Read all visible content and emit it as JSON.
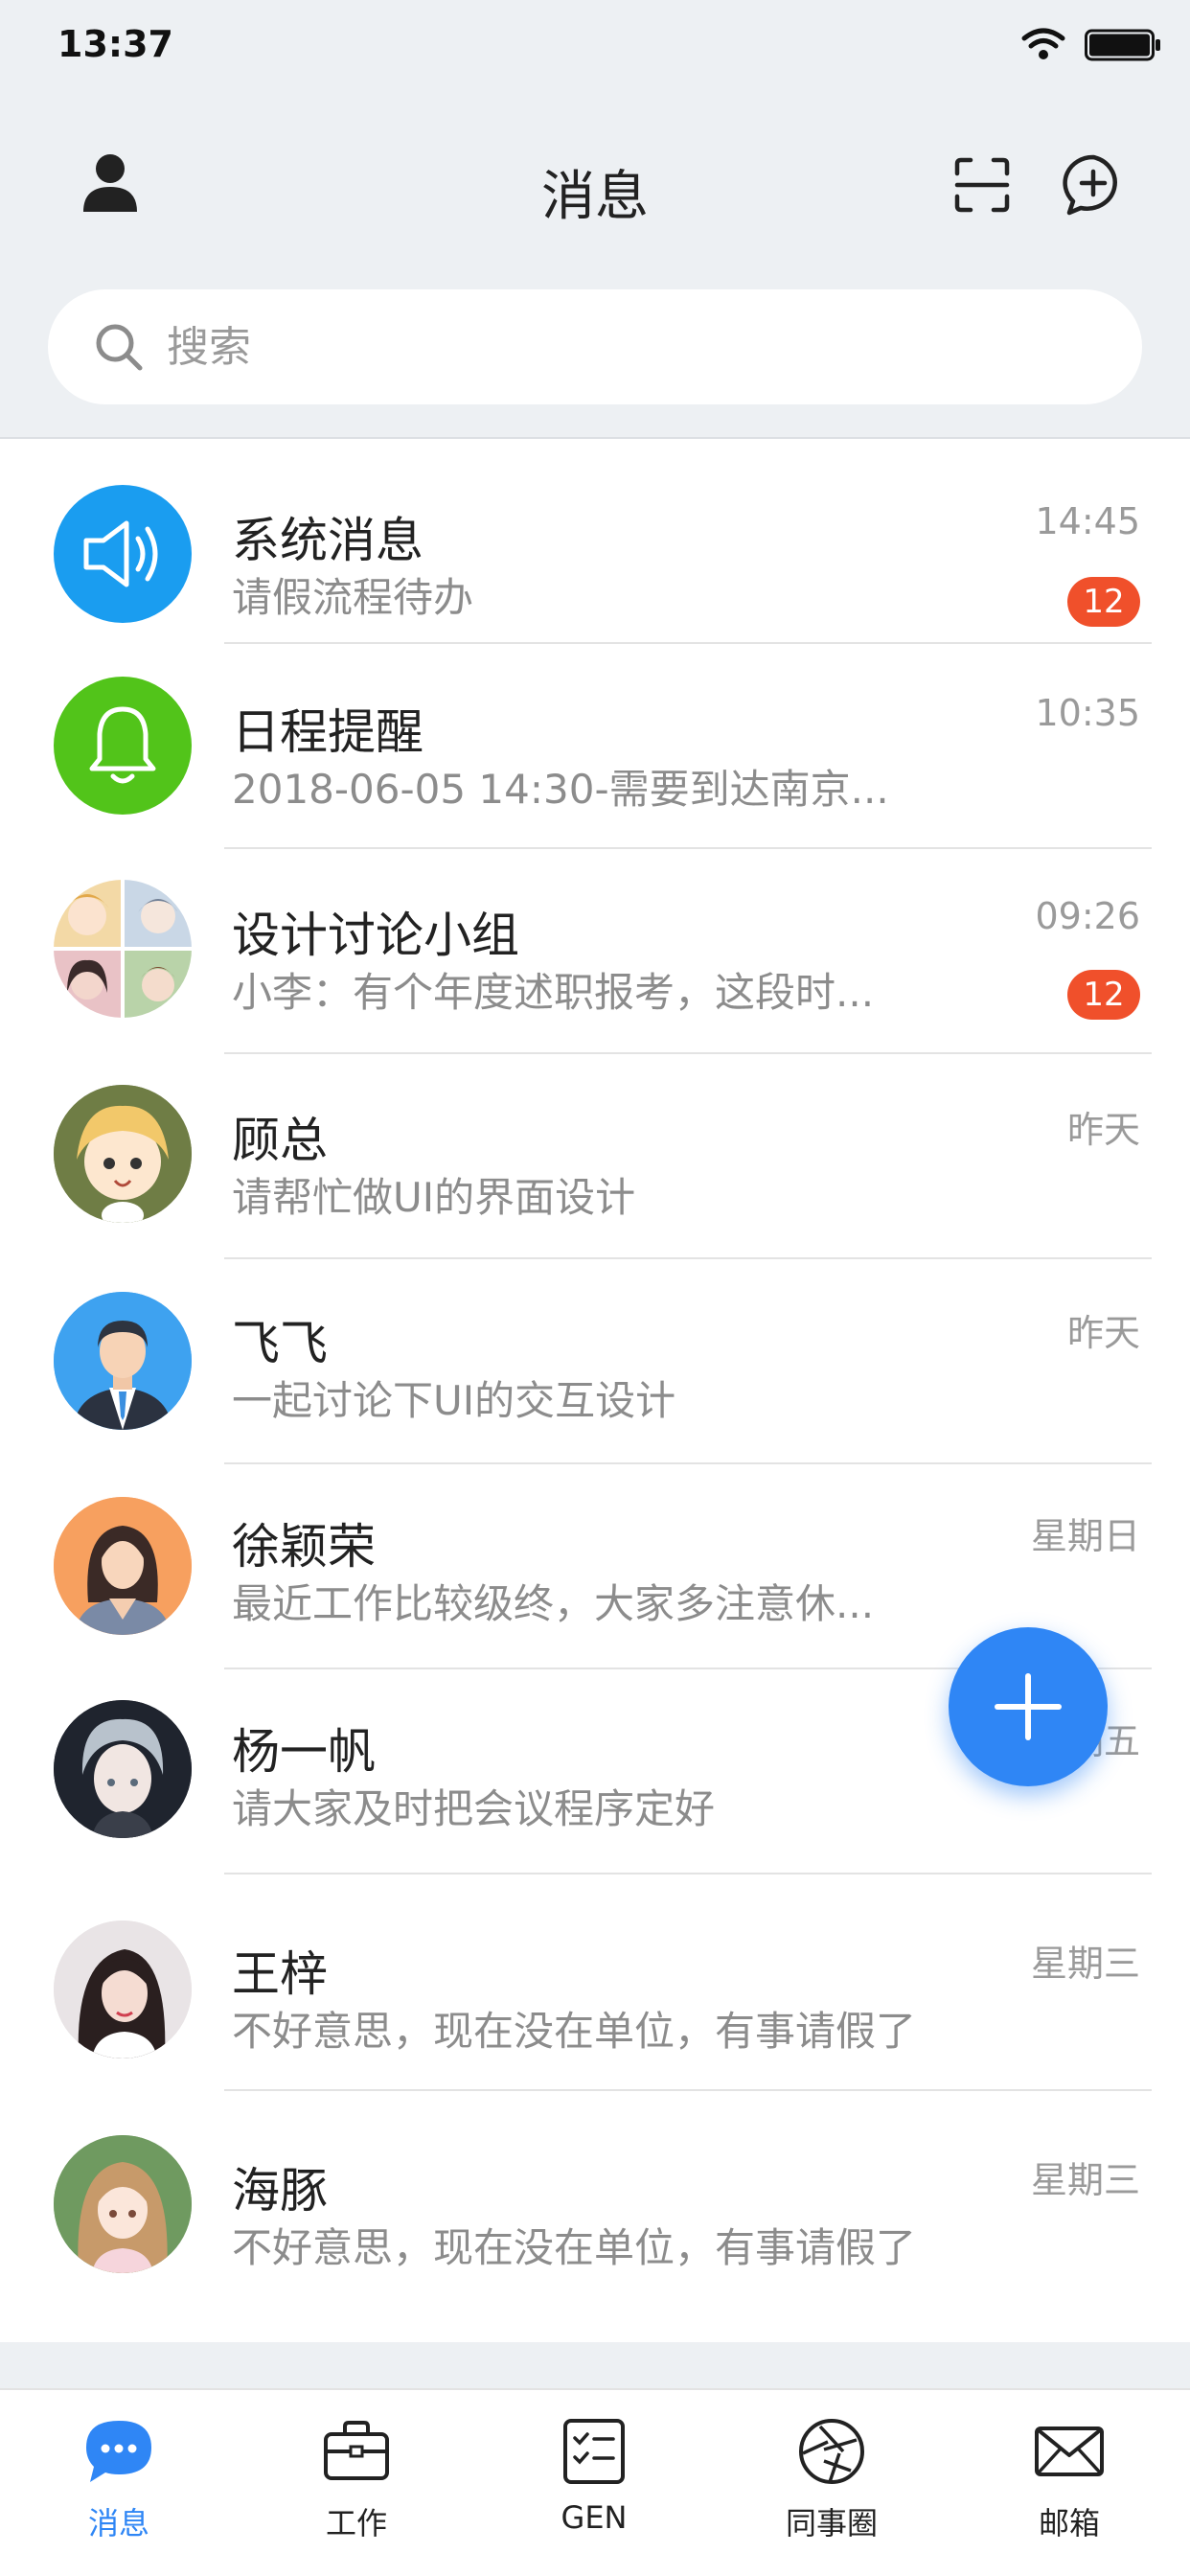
{
  "status_bar": {
    "time": "13:37"
  },
  "header": {
    "title": "消息"
  },
  "search": {
    "placeholder": "搜索"
  },
  "colors": {
    "accent": "#2f86f5",
    "badge": "#f0502b",
    "system_icon": "#1a9df0",
    "reminder_icon": "#52c41a"
  },
  "conversations": [
    {
      "name": "系统消息",
      "preview": "请假流程待办",
      "time": "14:45",
      "badge": "12",
      "avatar": "speaker-icon"
    },
    {
      "name": "日程提醒",
      "preview": "2018-06-05 14:30-需要到达南京...",
      "time": "10:35",
      "badge": "",
      "avatar": "bell-icon"
    },
    {
      "name": "设计讨论小组",
      "preview": "小李：有个年度述职报考，这段时...",
      "time": "09:26",
      "badge": "12",
      "avatar": "group-avatar"
    },
    {
      "name": "顾总",
      "preview": "请帮忙做UI的界面设计",
      "time": "昨天",
      "badge": "",
      "avatar": "anime-avatar"
    },
    {
      "name": "飞飞",
      "preview": "一起讨论下UI的交互设计",
      "time": "昨天",
      "badge": "",
      "avatar": "businessman-avatar"
    },
    {
      "name": "徐颖荣",
      "preview": "最近工作比较级终，大家多注意休...",
      "time": "星期日",
      "badge": "",
      "avatar": "woman-avatar"
    },
    {
      "name": "杨一帆",
      "preview": "请大家及时把会议程序定好",
      "time": "星期五",
      "badge": "",
      "avatar": "boy-avatar"
    },
    {
      "name": "王梓",
      "preview": "不好意思，现在没在单位，有事请假了",
      "time": "星期三",
      "badge": "",
      "avatar": "girl-photo-avatar"
    },
    {
      "name": "海豚",
      "preview": "不好意思，现在没在单位，有事请假了",
      "time": "星期三",
      "badge": "",
      "avatar": "anime-girl-avatar"
    }
  ],
  "tabbar": [
    {
      "label": "消息",
      "icon": "chat-bubble-icon",
      "active": true
    },
    {
      "label": "工作",
      "icon": "briefcase-icon",
      "active": false
    },
    {
      "label": "GEN",
      "icon": "checklist-icon",
      "active": false
    },
    {
      "label": "同事圈",
      "icon": "aperture-icon",
      "active": false
    },
    {
      "label": "邮箱",
      "icon": "mail-icon",
      "active": false
    }
  ]
}
